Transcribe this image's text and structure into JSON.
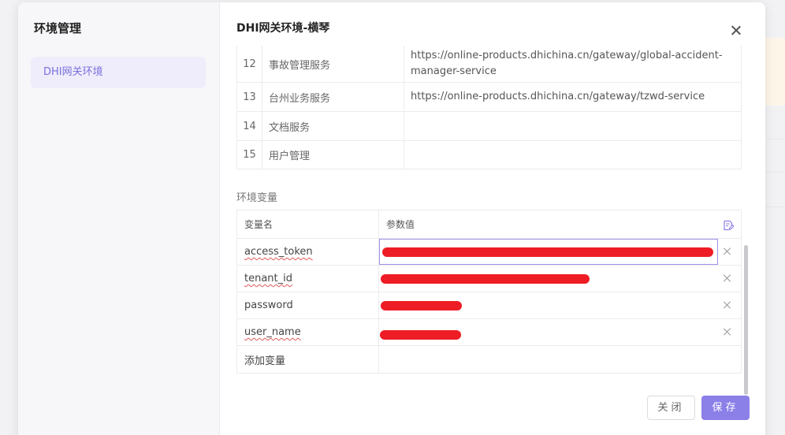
{
  "sidebar": {
    "title": "环境管理",
    "items": [
      {
        "label": "DHI网关环境"
      }
    ]
  },
  "dialog": {
    "title": "DHI网关环境-横琴"
  },
  "services": [
    {
      "index": "12",
      "name": "事故管理服务",
      "url": "https://online-products.dhichina.cn/gateway/global-accident-manager-service"
    },
    {
      "index": "13",
      "name": "台州业务服务",
      "url": "https://online-products.dhichina.cn/gateway/tzwd-service"
    },
    {
      "index": "14",
      "name": "文档服务",
      "url": ""
    },
    {
      "index": "15",
      "name": "用户管理",
      "url": ""
    }
  ],
  "env_vars": {
    "section_label": "环境变量",
    "header_name": "变量名",
    "header_value": "参数值",
    "rows": [
      {
        "name": "access_token"
      },
      {
        "name": "tenant_id"
      },
      {
        "name": "password"
      },
      {
        "name": "user_name"
      }
    ],
    "add_placeholder": "添加变量"
  },
  "footer": {
    "close_label": "关闭",
    "save_label": "保存"
  },
  "colors": {
    "accent": "#8b7fe8",
    "sidebar_active_bg": "#efedfb",
    "redaction": "#ee1c25"
  }
}
